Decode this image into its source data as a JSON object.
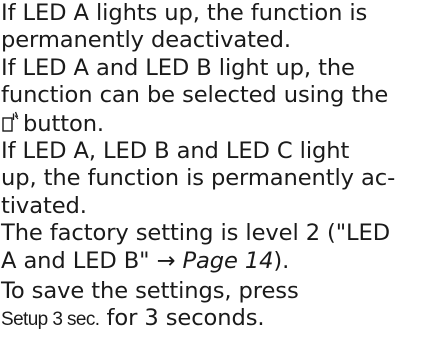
{
  "paragraphs": {
    "p1": {
      "line1": "If LED A lights up, the function is",
      "line2": "permanently deactivated."
    },
    "p2": {
      "line1": "If LED A and LED B light up, the",
      "line2": "function can be selected using the",
      "line3_after_icon": "button."
    },
    "p3": {
      "line1": "If LED A, LED B and LED C light",
      "line2": "up, the function is permanently ac-",
      "line3": "tivated."
    },
    "p4": {
      "line1": "The factory setting is level 2 (\"LED",
      "line2_before_link": "A and LED B\" → ",
      "link": "Page 14",
      "line2_after_link": ")."
    },
    "p5": {
      "line1": "To save the settings, press",
      "setup_label": "Setup 3 sec.",
      "line2_after_label": " for 3 seconds."
    }
  },
  "icons": {
    "button_icon": "button-press-icon"
  }
}
